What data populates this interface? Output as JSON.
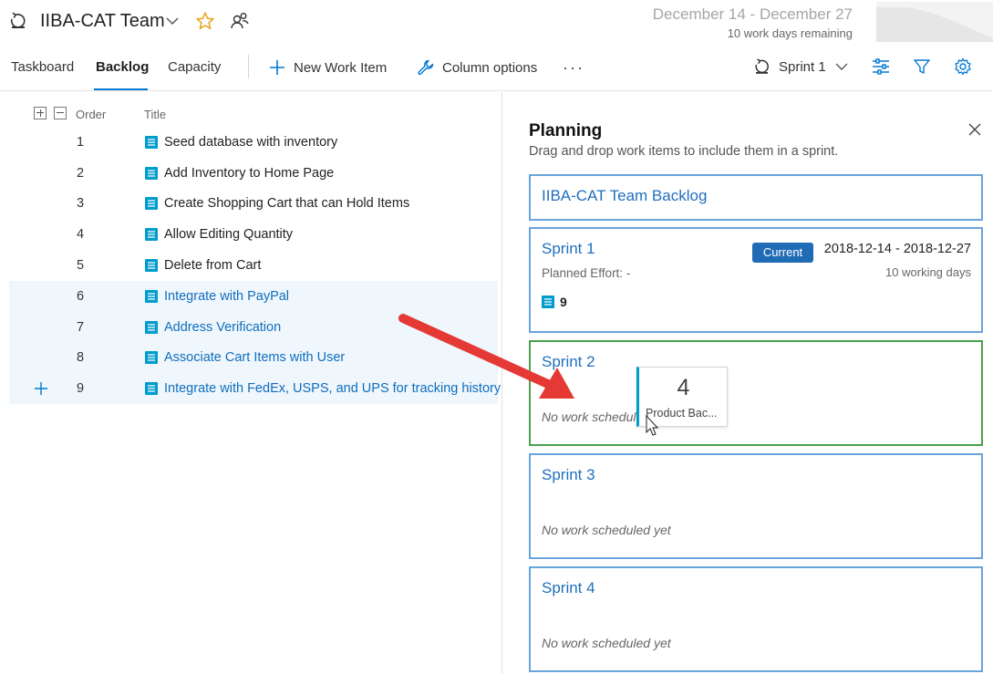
{
  "header": {
    "team_name": "IIBA-CAT Team",
    "date_range": "December 14 - December 27",
    "days_remaining": "10 work days remaining"
  },
  "toolbar": {
    "tabs": [
      {
        "label": "Taskboard",
        "active": false
      },
      {
        "label": "Backlog",
        "active": true
      },
      {
        "label": "Capacity",
        "active": false
      }
    ],
    "new_work_item_label": "New Work Item",
    "column_options_label": "Column options",
    "more_label": "···",
    "sprint_picker_label": "Sprint 1"
  },
  "grid": {
    "columns": {
      "order": "Order",
      "title": "Title"
    },
    "rows": [
      {
        "order": "1",
        "title": "Seed database with inventory",
        "selected": false
      },
      {
        "order": "2",
        "title": "Add Inventory to Home Page",
        "selected": false
      },
      {
        "order": "3",
        "title": "Create Shopping Cart that can Hold Items",
        "selected": false
      },
      {
        "order": "4",
        "title": "Allow Editing Quantity",
        "selected": false
      },
      {
        "order": "5",
        "title": "Delete from Cart",
        "selected": false
      },
      {
        "order": "6",
        "title": "Integrate with PayPal",
        "selected": true
      },
      {
        "order": "7",
        "title": "Address Verification",
        "selected": true
      },
      {
        "order": "8",
        "title": "Associate Cart Items with User",
        "selected": true
      },
      {
        "order": "9",
        "title": "Integrate with FedEx, USPS, and UPS for tracking history",
        "selected": true
      }
    ]
  },
  "planning": {
    "title": "Planning",
    "subtitle": "Drag and drop work items to include them in a sprint.",
    "backlog_card": {
      "name": "IIBA-CAT Team Backlog"
    },
    "sprint1": {
      "name": "Sprint 1",
      "badge": "Current",
      "dates": "2018-12-14 - 2018-12-27",
      "working_days": "10 working days",
      "effort": "Planned Effort: -",
      "item_count": "9"
    },
    "sprint2": {
      "name": "Sprint 2",
      "empty_text": "No work scheduled yet"
    },
    "sprint3": {
      "name": "Sprint 3",
      "empty_text": "No work scheduled yet"
    },
    "sprint4": {
      "name": "Sprint 4",
      "empty_text": "No work scheduled yet"
    }
  },
  "drag_ghost": {
    "count": "4",
    "label": "Product Bac..."
  },
  "colors": {
    "accent": "#0078d4",
    "link": "#1f6fbf",
    "selected_row": "#eff6fc",
    "drop_target_border": "#4ba04b",
    "arrow": "#e53935"
  }
}
